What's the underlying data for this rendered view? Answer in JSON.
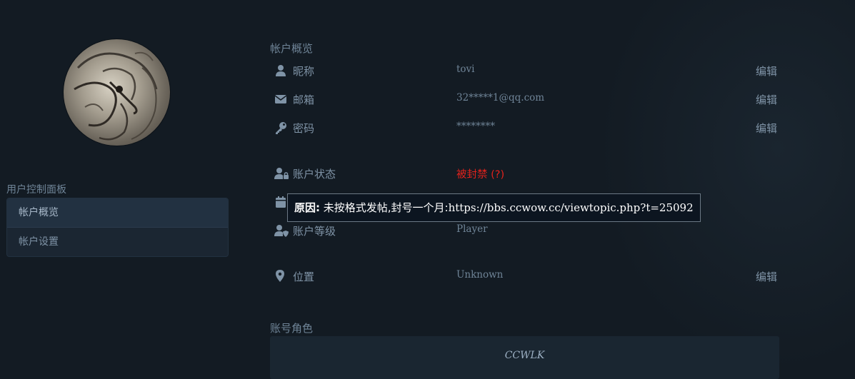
{
  "sidebar": {
    "title": "用户控制面板",
    "items": [
      {
        "label": "帐户概览",
        "active": true
      },
      {
        "label": "帐户设置",
        "active": false
      }
    ]
  },
  "overview": {
    "title": "帐户概览",
    "rows": [
      {
        "icon": "user-icon",
        "label": "昵称",
        "value": "tovi",
        "action": "编辑"
      },
      {
        "icon": "envelope-icon",
        "label": "邮箱",
        "value": "32*****1@qq.com",
        "action": "编辑"
      },
      {
        "icon": "key-icon",
        "label": "密码",
        "value": "********",
        "action": "编辑"
      },
      {
        "icon": "user-lock-icon",
        "label": "账户状态",
        "value": "被封禁 (?)",
        "action": ""
      },
      {
        "icon": "calendar-icon",
        "label": "",
        "value": "",
        "action": ""
      },
      {
        "icon": "user-shield-icon",
        "label": "账户等级",
        "value": "Player",
        "action": ""
      },
      {
        "icon": "map-marker-icon",
        "label": "位置",
        "value": "Unknown",
        "action": "编辑"
      }
    ]
  },
  "tooltip": {
    "reason_label": "原因:",
    "reason_text": " 未按格式发帖,封号一个月:",
    "reason_link": "https://bbs.ccwow.cc/viewtopic.php?t=25092"
  },
  "characters": {
    "title": "账号角色",
    "list": [
      "CCWLK"
    ]
  },
  "colors": {
    "background": "#131b23",
    "banned": "#e2221c",
    "text": "#7f93a6"
  }
}
